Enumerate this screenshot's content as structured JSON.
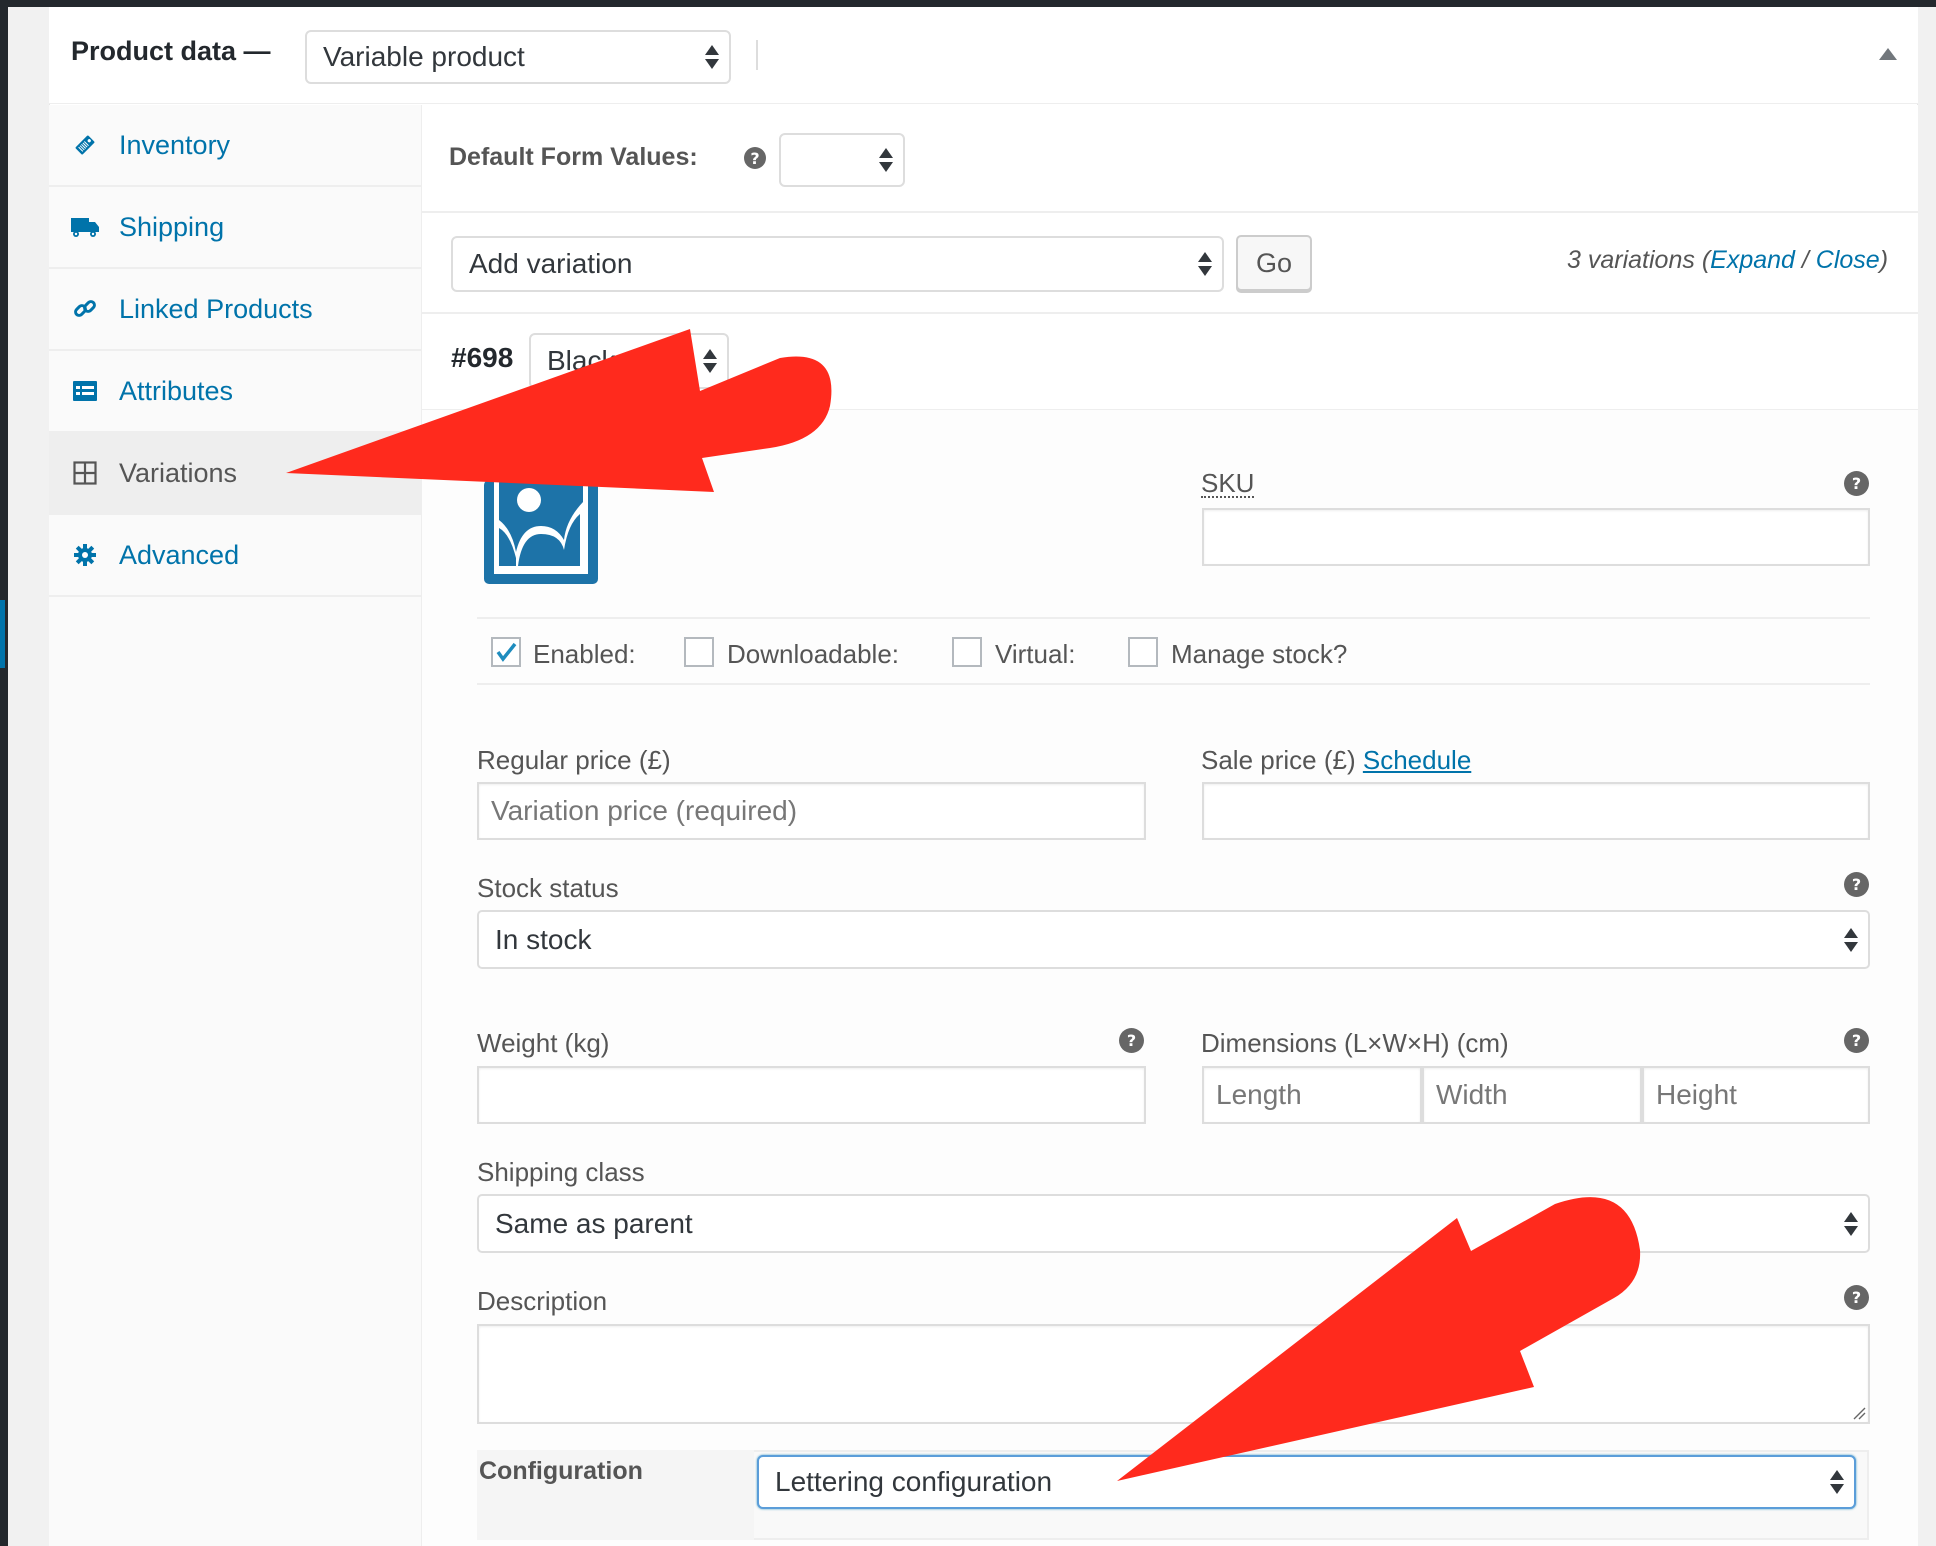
{
  "header": {
    "title": "Product data —",
    "product_type": "Variable product"
  },
  "sidebar": {
    "items": [
      {
        "label": "Inventory",
        "icon": "tag-icon",
        "active": false
      },
      {
        "label": "Shipping",
        "icon": "truck-icon",
        "active": false
      },
      {
        "label": "Linked Products",
        "icon": "link-icon",
        "active": false
      },
      {
        "label": "Attributes",
        "icon": "list-icon",
        "active": false
      },
      {
        "label": "Variations",
        "icon": "grid-icon",
        "active": true
      },
      {
        "label": "Advanced",
        "icon": "gear-icon",
        "active": false
      }
    ]
  },
  "defaults": {
    "label": "Default Form Values:",
    "value": ""
  },
  "toolbar": {
    "action_value": "Add variation",
    "go_label": "Go",
    "count_text": "3 variations",
    "open_paren": "(",
    "expand_label": "Expand",
    "slash": "/",
    "close_label": "Close",
    "close_paren": ")"
  },
  "variation": {
    "id": "#698",
    "attribute_value": "Black",
    "sku": {
      "label": "SKU",
      "value": ""
    },
    "checkboxes": [
      {
        "label": "Enabled:",
        "checked": true
      },
      {
        "label": "Downloadable:",
        "checked": false
      },
      {
        "label": "Virtual:",
        "checked": false
      },
      {
        "label": "Manage stock?",
        "checked": false
      }
    ],
    "regular_price": {
      "label": "Regular price (£)",
      "placeholder": "Variation price (required)",
      "value": ""
    },
    "sale_price": {
      "label": "Sale price (£)",
      "schedule_link": "Schedule",
      "value": ""
    },
    "stock_status": {
      "label": "Stock status",
      "value": "In stock"
    },
    "weight": {
      "label": "Weight (kg)",
      "value": ""
    },
    "dimensions": {
      "label": "Dimensions (L×W×H) (cm)",
      "length_placeholder": "Length",
      "width_placeholder": "Width",
      "height_placeholder": "Height"
    },
    "shipping_class": {
      "label": "Shipping class",
      "value": "Same as parent"
    },
    "description": {
      "label": "Description",
      "value": ""
    },
    "configuration": {
      "label": "Configuration",
      "value": "Lettering configuration"
    }
  },
  "help_glyph": "?",
  "colors": {
    "link": "#0073aa",
    "annotation_arrow": "#ff2a1d",
    "focus_border": "#5b9dd9"
  }
}
